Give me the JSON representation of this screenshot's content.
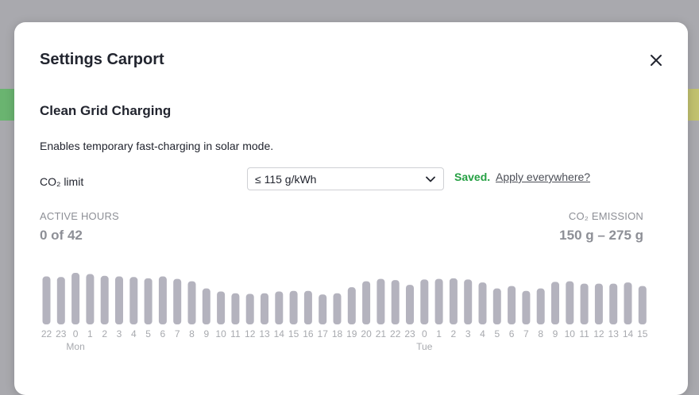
{
  "modal": {
    "title": "Settings Carport",
    "section_title": "Clean Grid Charging",
    "description": "Enables temporary fast-charging in solar mode.",
    "co2_limit": {
      "label": "CO₂ limit",
      "selected": "≤ 115 g/kWh",
      "status": "Saved.",
      "apply_link": "Apply everywhere?"
    },
    "active_hours": {
      "label": "ACTIVE HOURS",
      "value": "0 of 42"
    },
    "co2_emission": {
      "label": "CO₂ EMISSION",
      "value": "150 g – 275 g"
    }
  },
  "colors": {
    "saved": "#25a043",
    "bar": "#b4b3be",
    "background_overlay": "#a9a9ae"
  },
  "icons": {
    "close": "close-icon",
    "dropdown": "chevron-down-icon"
  },
  "chart_data": {
    "type": "bar",
    "categories": [
      "22",
      "23",
      "0",
      "1",
      "2",
      "3",
      "4",
      "5",
      "6",
      "7",
      "8",
      "9",
      "10",
      "11",
      "12",
      "13",
      "14",
      "15",
      "16",
      "17",
      "18",
      "19",
      "20",
      "21",
      "22",
      "23",
      "0",
      "1",
      "2",
      "3",
      "4",
      "5",
      "6",
      "7",
      "8",
      "9",
      "10",
      "11",
      "12",
      "13",
      "14",
      "15"
    ],
    "day_labels": [
      {
        "index": 2,
        "label": "Mon"
      },
      {
        "index": 26,
        "label": "Tue"
      }
    ],
    "values": [
      80,
      79,
      86,
      84,
      81,
      80,
      79,
      77,
      80,
      76,
      72,
      60,
      55,
      52,
      51,
      52,
      55,
      56,
      56,
      50,
      52,
      62,
      72,
      76,
      74,
      66,
      75,
      76,
      77,
      75,
      70,
      60,
      64,
      56,
      60,
      71,
      72,
      68,
      68,
      68,
      70,
      64
    ],
    "ylim": [
      0,
      90
    ],
    "xlabel": "",
    "ylabel": ""
  }
}
